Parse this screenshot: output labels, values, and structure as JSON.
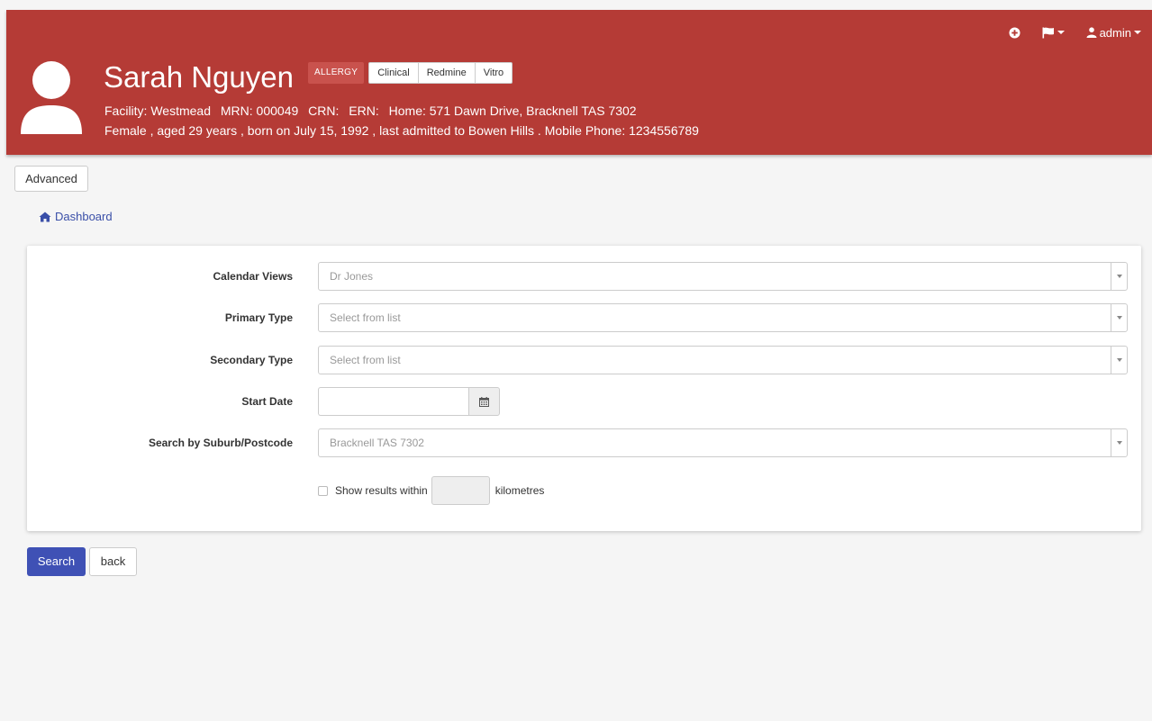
{
  "topnav": {
    "add_icon": "plus-circle-icon",
    "flag_icon": "flag-icon",
    "user_icon": "user-icon",
    "user_label": "admin"
  },
  "patient": {
    "name": "Sarah Nguyen",
    "allergy_tag": "ALLERGY",
    "tabs": [
      "Clinical",
      "Redmine",
      "Vitro"
    ],
    "details_line1": [
      "Facility: Westmead",
      "MRN: 000049",
      "CRN:",
      "ERN:",
      "Home: 571 Dawn Drive, Bracknell TAS 7302"
    ],
    "details_line2": "Female , aged 29 years , born on July 15, 1992 , last admitted to Bowen Hills . Mobile Phone: 1234556789"
  },
  "advanced_label": "Advanced",
  "breadcrumb": {
    "label": "Dashboard",
    "icon": "home-icon"
  },
  "form": {
    "calendar_views": {
      "label": "Calendar Views",
      "value": "Dr Jones"
    },
    "primary_type": {
      "label": "Primary Type",
      "placeholder": "Select from list"
    },
    "secondary_type": {
      "label": "Secondary Type",
      "placeholder": "Select from list"
    },
    "start_date": {
      "label": "Start Date",
      "value": "",
      "icon": "calendar-icon"
    },
    "suburb": {
      "label": "Search by Suburb/Postcode",
      "value": "Bracknell TAS 7302"
    },
    "within": {
      "label": "Show results within",
      "unit": "kilometres",
      "value": ""
    }
  },
  "actions": {
    "search": "Search",
    "back": "back"
  },
  "colors": {
    "header": "#b53b36",
    "primary": "#3f51b5",
    "link": "#3a4fa8"
  }
}
